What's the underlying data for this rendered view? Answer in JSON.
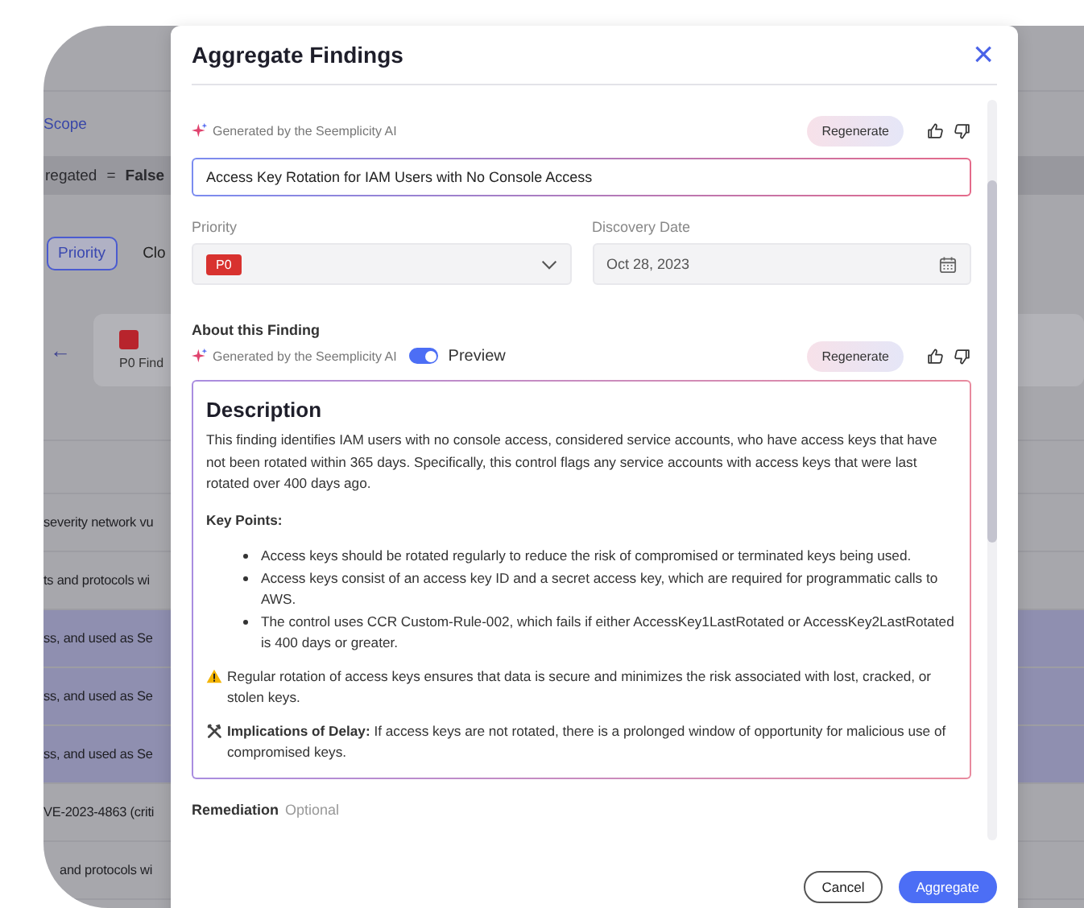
{
  "background": {
    "scope_link": "Scope",
    "filter": {
      "field": "regated",
      "operator": "=",
      "value": "False"
    },
    "tabs": [
      {
        "label": "Priority",
        "selected": true
      },
      {
        "label": "Clo",
        "selected": false
      }
    ],
    "back_arrow": "←",
    "summary_card": {
      "label": "P0 Find",
      "color": "#b8242c"
    },
    "rows": [
      {
        "text": "severity network vu",
        "highlighted": false
      },
      {
        "text": "ts and protocols wi",
        "highlighted": false
      },
      {
        "text": "ss, and used as Se",
        "highlighted": true
      },
      {
        "text": "ss, and used as Se",
        "highlighted": true
      },
      {
        "text": "ss, and used as Se",
        "highlighted": true
      },
      {
        "text": "VE-2023-4863 (criti",
        "highlighted": false
      },
      {
        "text": "and protocols wi",
        "highlighted": false
      }
    ]
  },
  "dialog": {
    "title": "Aggregate Findings",
    "close": "×",
    "title_field": {
      "ai_label": "Generated by the Seemplicity AI",
      "regenerate": "Regenerate",
      "value": "Access Key Rotation for IAM Users with No Console Access"
    },
    "priority": {
      "label": "Priority",
      "value": "P0"
    },
    "discovery_date": {
      "label": "Discovery Date",
      "value": "Oct 28, 2023"
    },
    "about": {
      "heading": "About this Finding",
      "ai_label": "Generated by the Seemplicity AI",
      "preview": {
        "label": "Preview",
        "on": true
      },
      "regenerate": "Regenerate",
      "description": {
        "heading": "Description",
        "paragraph": "This finding identifies IAM users with no console access, considered service accounts, who have access keys that have not been rotated within 365 days. Specifically, this control flags any service accounts with access keys that were last rotated over 400 days ago.",
        "key_points_label": "Key Points:",
        "bullets": [
          "Access keys should be rotated regularly to reduce the risk of compromised or terminated keys being used.",
          "Access keys consist of an access key ID and a secret access key, which are required for programmatic calls to AWS.",
          "The control uses CCR Custom-Rule-002, which fails if either AccessKey1LastRotated or AccessKey2LastRotated is 400 days or greater."
        ],
        "warning": "Regular rotation of access keys ensures that data is secure and minimizes the risk associated with lost, cracked, or stolen keys.",
        "implications": "**Implications of Delay:** If access keys are not rotated, there is a prolonged window of opportunity for malicious use of compromised keys."
      }
    },
    "remediation": {
      "label": "Remediation",
      "hint": "Optional"
    },
    "buttons": [
      {
        "label": "Cancel",
        "kind": "secondary"
      },
      {
        "label": "Aggregate",
        "kind": "primary"
      }
    ]
  }
}
